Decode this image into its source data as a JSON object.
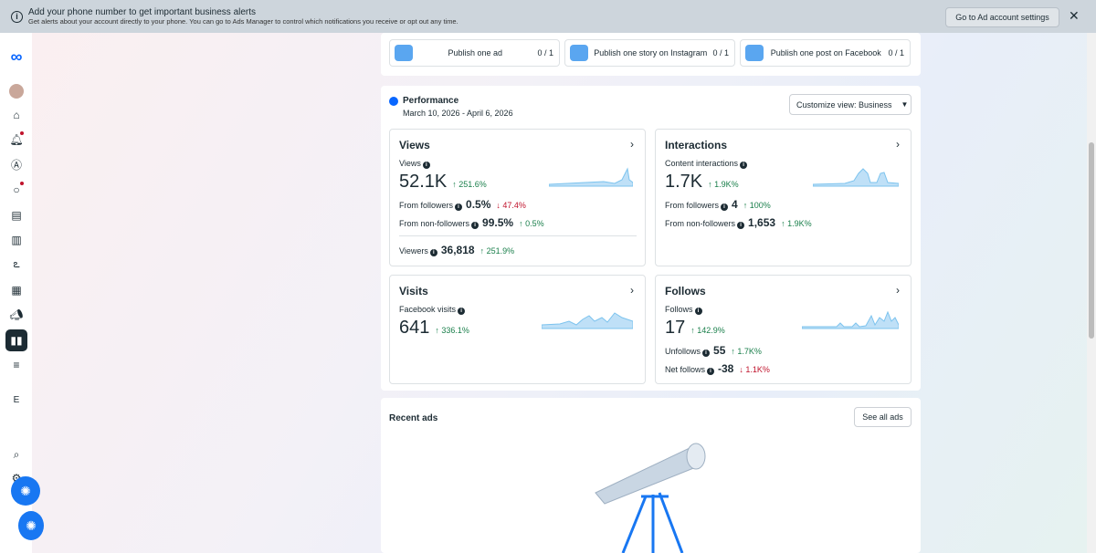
{
  "banner": {
    "title": "Add your phone number to get important business alerts",
    "subtitle": "Get alerts about your account directly to your phone. You can go to Ads Manager to control which notifications you receive or opt out any time.",
    "button": "Go to Ad account settings"
  },
  "sidebar": {
    "letter": "E"
  },
  "tasks": [
    {
      "label": "Publish one ad",
      "count": "0 / 1"
    },
    {
      "label": "Publish one story on Instagram",
      "count": "0 / 1"
    },
    {
      "label": "Publish one post on Facebook",
      "count": "0 / 1"
    }
  ],
  "performance": {
    "title": "Performance",
    "date_range": "March 10, 2026 - April 6, 2026",
    "customize": "Customize view: Business",
    "views": {
      "title": "Views",
      "metric": "Views",
      "value": "52.1K",
      "change": "251.6%",
      "from_followers_label": "From followers",
      "from_followers": "0.5%",
      "from_followers_change": "47.4%",
      "non_followers_label": "From non-followers",
      "non_followers": "99.5%",
      "non_followers_change": "0.5%",
      "viewers_label": "Viewers",
      "viewers": "36,818",
      "viewers_change": "251.9%"
    },
    "interactions": {
      "title": "Interactions",
      "metric": "Content interactions",
      "value": "1.7K",
      "change": "1.9K%",
      "from_followers_label": "From followers",
      "from_followers": "4",
      "from_followers_change": "100%",
      "non_followers_label": "From non-followers",
      "non_followers": "1,653",
      "non_followers_change": "1.9K%"
    },
    "visits": {
      "title": "Visits",
      "metric": "Facebook visits",
      "value": "641",
      "change": "336.1%"
    },
    "follows": {
      "title": "Follows",
      "metric": "Follows",
      "value": "17",
      "change": "142.9%",
      "unfollows_label": "Unfollows",
      "unfollows": "55",
      "unfollows_change": "1.7K%",
      "net_label": "Net follows",
      "net": "-38",
      "net_change": "1.1K%"
    }
  },
  "recent_ads": {
    "title": "Recent ads",
    "see_all": "See all ads"
  }
}
